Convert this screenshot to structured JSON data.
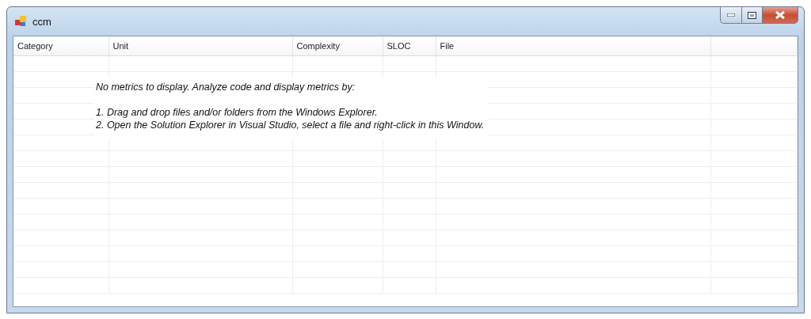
{
  "window": {
    "title": "ccm"
  },
  "table": {
    "columns": [
      "Category",
      "Unit",
      "Complexity",
      "SLOC",
      "File"
    ]
  },
  "empty_message": {
    "heading": "No metrics to display. Analyze code and display metrics by:",
    "steps": [
      "1. Drag and drop files and/or folders from the Windows Explorer.",
      "2. Open the Solution Explorer in Visual Studio, select a file and right-click in this Window."
    ]
  }
}
